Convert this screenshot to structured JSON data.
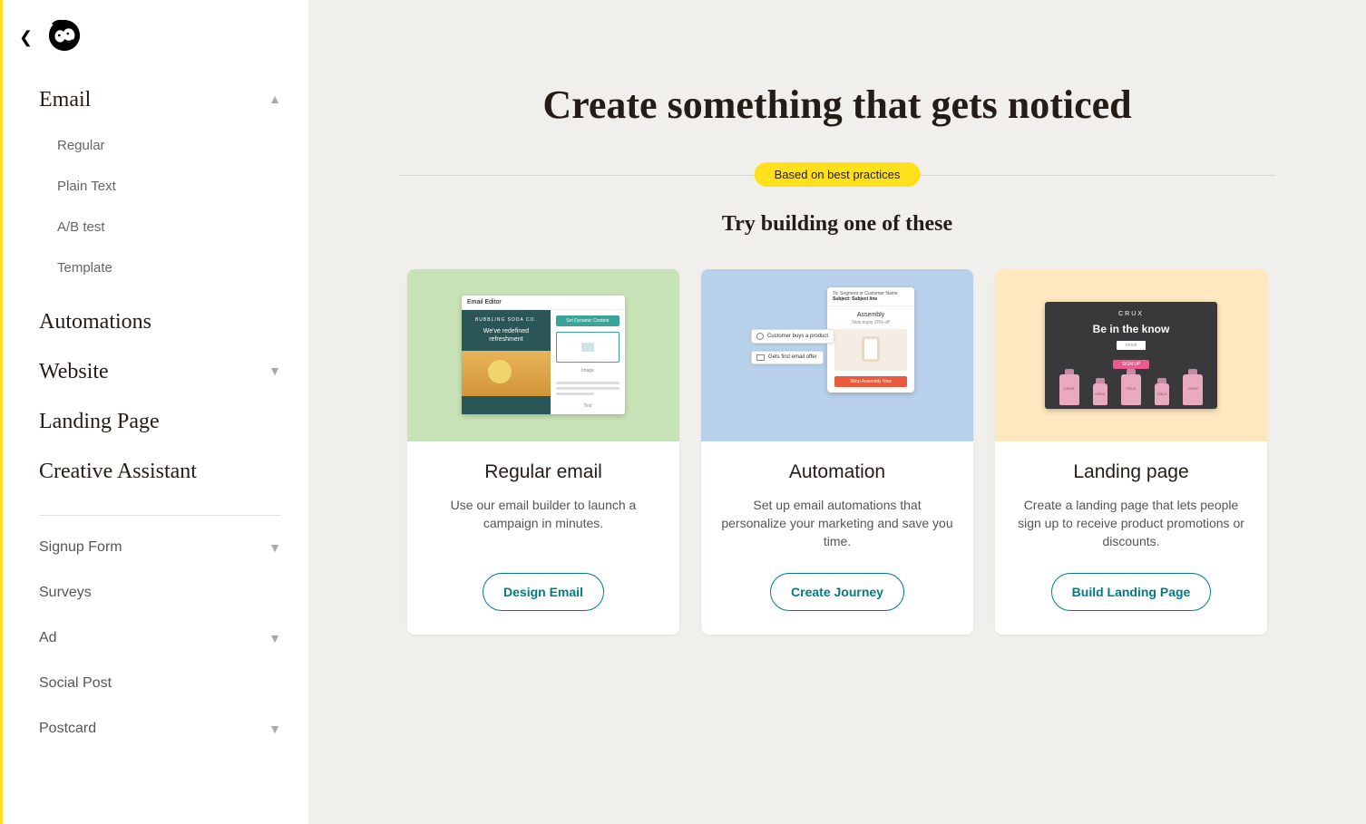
{
  "sidebar": {
    "email_label": "Email",
    "email_items": [
      "Regular",
      "Plain Text",
      "A/B test",
      "Template"
    ],
    "automations_label": "Automations",
    "website_label": "Website",
    "landing_page_label": "Landing Page",
    "creative_assistant_label": "Creative Assistant",
    "secondary": [
      "Signup Form",
      "Surveys",
      "Ad",
      "Social Post",
      "Postcard"
    ],
    "secondary_chevron": [
      true,
      false,
      true,
      false,
      true
    ]
  },
  "main": {
    "headline": "Create something that gets noticed",
    "badge": "Based on best practices",
    "subhead": "Try building one of these",
    "cards": [
      {
        "title": "Regular email",
        "desc": "Use our email builder to launch a campaign in minutes.",
        "cta": "Design Email"
      },
      {
        "title": "Automation",
        "desc": "Set up email automations that personalize your marketing and save you time.",
        "cta": "Create Journey"
      },
      {
        "title": "Landing page",
        "desc": "Create a landing page that lets people sign up to receive product promotions or discounts.",
        "cta": "Build Landing Page"
      }
    ],
    "thumb": {
      "email_editor": "Email Editor",
      "brand": "BUBBLING SODA CO.",
      "line1": "We've redefined",
      "line2": "refreshment",
      "dynamic": "Set Dynamic Content",
      "image_label": "Image",
      "text_label": "Text",
      "auto_from": "To: Segment or Customer Name",
      "auto_subj": "Subject: Subject line",
      "assembly": "Assembly",
      "coupon": "Now enjoy 20% off",
      "shop": "Shop Assembly Now",
      "chip1": "Customer buys a product",
      "chip2": "Gets first email offer",
      "lp_brand": "CRUX",
      "lp_tag": "Be in the know",
      "lp_email": "email",
      "lp_signup": "SIGN UP"
    }
  }
}
